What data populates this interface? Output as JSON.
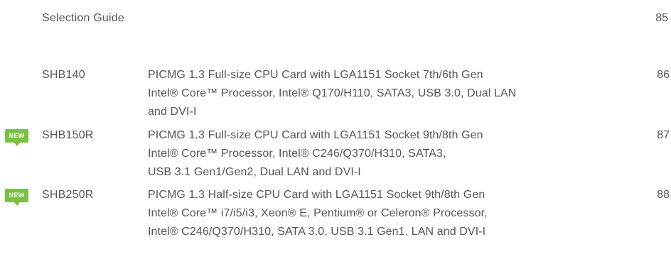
{
  "guide": {
    "title": "Selection Guide",
    "page": "85"
  },
  "entries": [
    {
      "model": "SHB140",
      "badge": "",
      "lines": [
        "PICMG 1.3 Full-size CPU Card with LGA1151 Socket 7th/6th Gen",
        "Intel® Core™ Processor, Intel® Q170/H110, SATA3, USB 3.0, Dual LAN",
        "and DVI-I"
      ],
      "page": "86"
    },
    {
      "model": "SHB150R",
      "badge": "NEW",
      "lines": [
        "PICMG 1.3 Full-size CPU Card with LGA1151 Socket 9th/8th Gen",
        "Intel® Core™ Processor, Intel® C246/Q370/H310, SATA3,",
        "USB 3.1 Gen1/Gen2, Dual LAN and DVI-I"
      ],
      "page": "87"
    },
    {
      "model": "SHB250R",
      "badge": "NEW",
      "lines": [
        "PICMG 1.3 Half-size CPU Card with LGA1151 Socket 9th/8th Gen",
        "Intel® Core™ i7/i5/i3, Xeon® E, Pentium® or Celeron® Processor,",
        "Intel® C246/Q370/H310, SATA 3.0, USB 3.1 Gen1, LAN and DVI-I"
      ],
      "page": "88"
    }
  ],
  "colors": {
    "text": "#555555",
    "badge": "#7ac043",
    "badge_text": "#ffffff"
  }
}
